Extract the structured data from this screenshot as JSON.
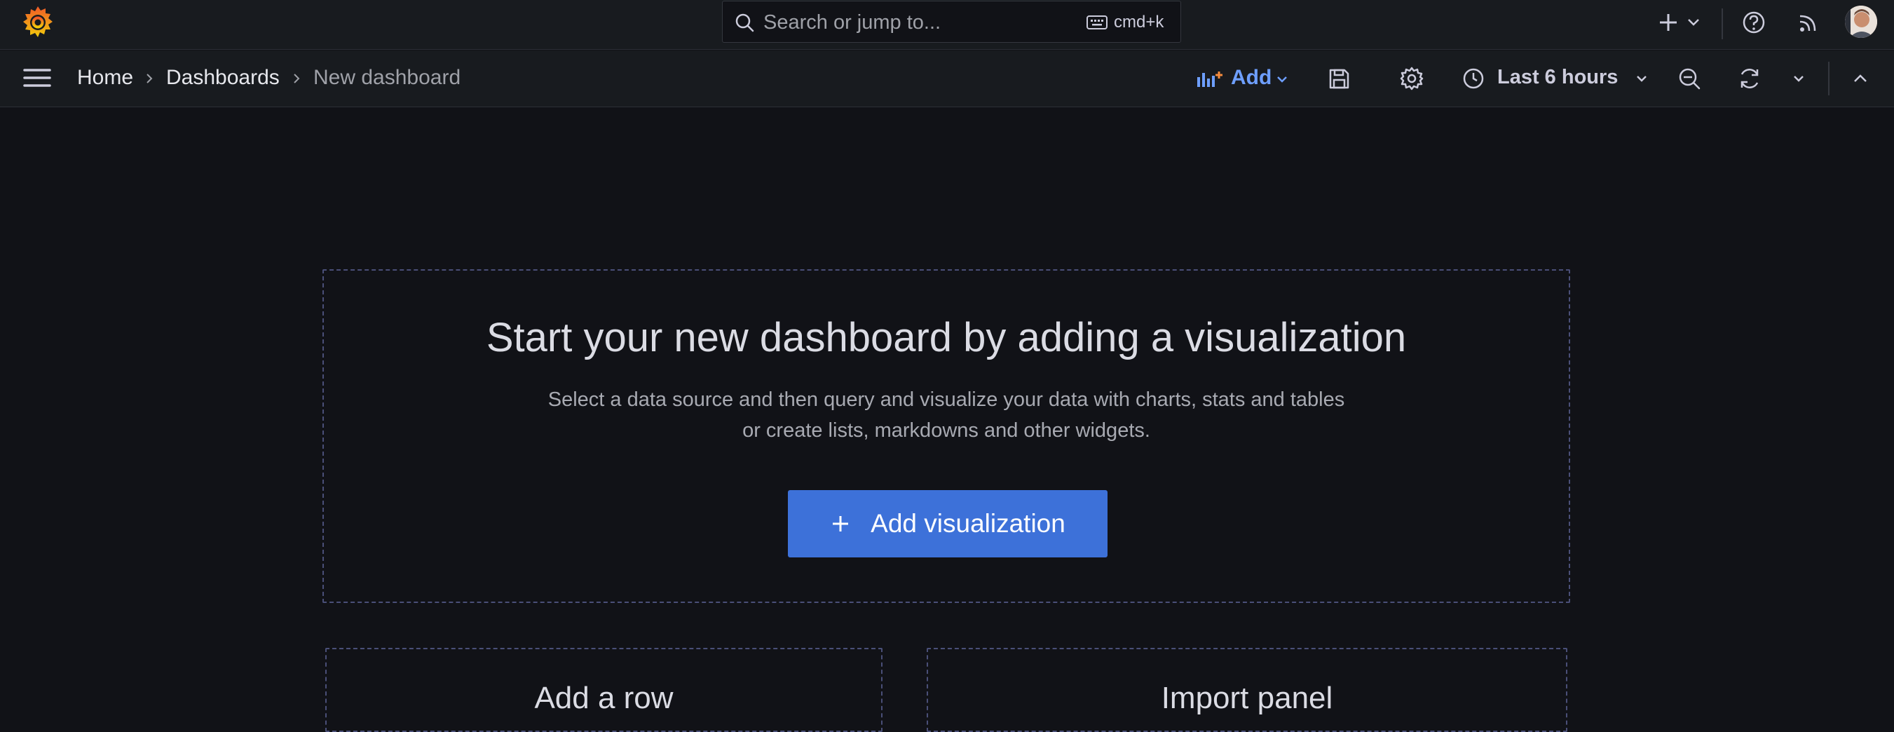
{
  "topbar": {
    "logo_icon": "grafana-logo-icon",
    "search": {
      "placeholder": "Search or jump to...",
      "shortcut": "cmd+k"
    },
    "icons": [
      "plus-icon",
      "chevron-down-icon",
      "help-icon",
      "rss-icon"
    ]
  },
  "navbar": {
    "breadcrumbs": [
      "Home",
      "Dashboards",
      "New dashboard"
    ],
    "add_label": "Add",
    "time_range": "Last 6 hours"
  },
  "empty_state": {
    "title": "Start your new dashboard by adding a visualization",
    "description_line1": "Select a data source and then query and visualize your data with charts, stats and tables",
    "description_line2": "or create lists, markdowns and other widgets.",
    "add_visualization_label": "Add visualization"
  },
  "cards": {
    "add_row": "Add a row",
    "import_panel": "Import panel"
  },
  "colors": {
    "background": "#111217",
    "bar": "#181b1f",
    "accent": "#6e9fff",
    "primary_button": "#3d71d9",
    "dashed_border": "#4a4f78"
  }
}
